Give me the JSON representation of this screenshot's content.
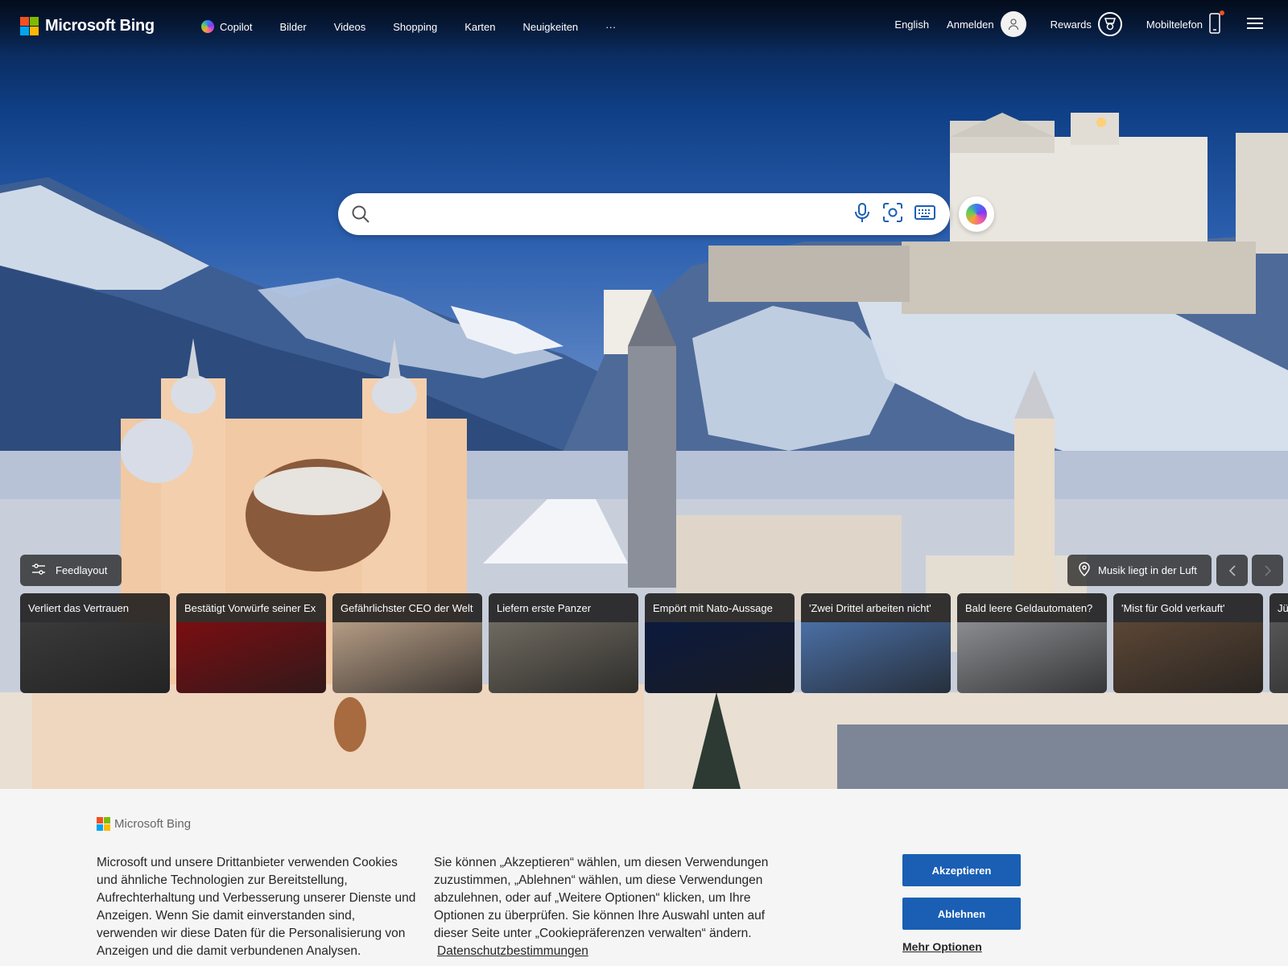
{
  "brand": {
    "name": "Microsoft Bing",
    "logo_colors": [
      "#f25022",
      "#7fba00",
      "#00a4ef",
      "#ffb900"
    ]
  },
  "nav": {
    "items": [
      {
        "label": "Copilot",
        "icon": "copilot-icon"
      },
      {
        "label": "Bilder"
      },
      {
        "label": "Videos"
      },
      {
        "label": "Shopping"
      },
      {
        "label": "Karten"
      },
      {
        "label": "Neuigkeiten"
      },
      {
        "label": "···",
        "icon": "more-icon"
      }
    ]
  },
  "header_right": {
    "language": "English",
    "signin": "Anmelden",
    "rewards": "Rewards",
    "mobile": "Mobiltelefon"
  },
  "search": {
    "placeholder": "",
    "icons": [
      "search-icon",
      "microphone-icon",
      "visual-search-icon",
      "keyboard-icon",
      "copilot-icon"
    ]
  },
  "feed": {
    "layout_label": "Feedlayout",
    "music_label": "Musik liegt in der Luft",
    "cards": [
      {
        "title": "Verliert das Vertrauen",
        "bg": "#3a3a3a"
      },
      {
        "title": "Bestätigt Vorwürfe seiner Ex",
        "bg": "#7a0e12"
      },
      {
        "title": "Gefährlichster CEO der Welt",
        "bg": "#b49b84"
      },
      {
        "title": "Liefern erste Panzer",
        "bg": "#6f6a60"
      },
      {
        "title": "Empört mit Nato-Aussage",
        "bg": "#0c1a3d"
      },
      {
        "title": "'Zwei Drittel arbeiten nicht'",
        "bg": "#4a6fa5"
      },
      {
        "title": "Bald leere Geldautomaten?",
        "bg": "#8a8c90"
      },
      {
        "title": "'Mist für Gold verkauft'",
        "bg": "#5b4635"
      },
      {
        "title": "Jü",
        "bg": "#555555"
      }
    ]
  },
  "cookie": {
    "logo": "Microsoft Bing",
    "left_text": "Microsoft und unsere Drittanbieter verwenden Cookies und ähnliche Technologien zur Bereitstellung, Aufrechterhaltung und Verbesserung unserer Dienste und Anzeigen. Wenn Sie damit einverstanden sind, verwenden wir diese Daten für die Personalisierung von Anzeigen und die damit verbundenen Analysen.",
    "right_text": "Sie können „Akzeptieren“ wählen, um diesen Verwendungen zuzustimmen, „Ablehnen“ wählen, um diese Verwendungen abzulehnen, oder auf „Weitere Optionen“ klicken, um Ihre Optionen zu überprüfen. Sie können Ihre Auswahl unten auf dieser Seite unter „Cookiepräferenzen verwalten“ ändern.",
    "privacy_link": "Datenschutzbestimmungen",
    "accept": "Akzeptieren",
    "reject": "Ablehnen",
    "more": "Mehr Optionen"
  }
}
